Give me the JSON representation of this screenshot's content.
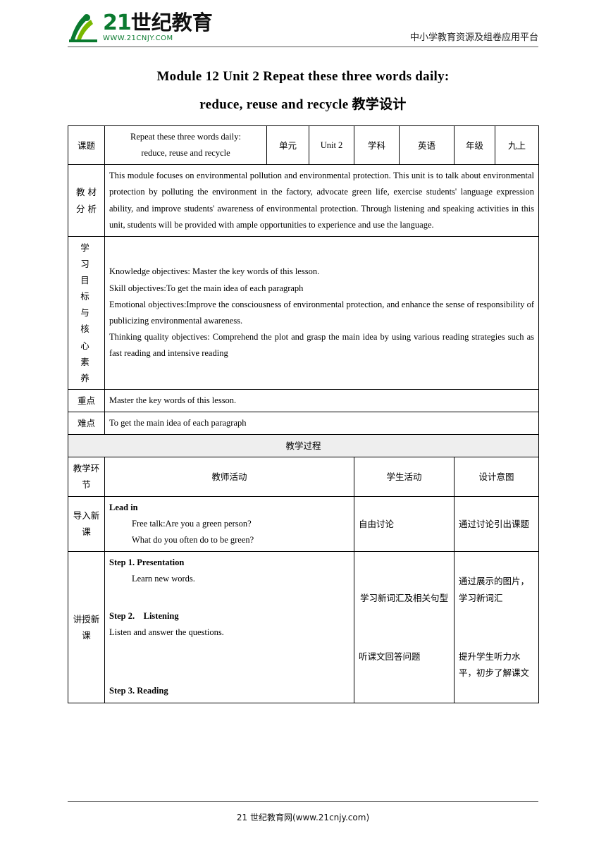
{
  "header": {
    "logo_number": "21",
    "logo_word": "世纪教育",
    "logo_url": "WWW.21CNJY.COM",
    "subtitle": "中小学教育资源及组卷应用平台"
  },
  "title": {
    "line1": "Module 12 Unit 2 Repeat these three words daily:",
    "line2": "reduce, reuse and recycle 教学设计"
  },
  "info": {
    "topic_label": "课题",
    "topic_value_line1": "Repeat these three words daily:",
    "topic_value_line2": "reduce, reuse and recycle",
    "unit_label": "单元",
    "unit_value": "Unit 2",
    "subject_label": "学科",
    "subject_value": "英语",
    "grade_label": "年级",
    "grade_value": "九上",
    "analysis_label_line1": "教 材",
    "analysis_label_line2": "分 析",
    "analysis_text": "This module focuses on environmental pollution and environmental protection. This unit is to talk about environmental protection by polluting the environment in the factory, advocate green life, exercise students' language expression ability, and improve students' awareness of environmental protection. Through listening and speaking activities in this unit, students will be provided with ample opportunities to experience and use the language.",
    "objectives_label": [
      "学 习",
      "目 标",
      "与 核",
      "心 素",
      "养"
    ],
    "objectives": [
      "Knowledge objectives: Master the key words of this lesson.",
      "Skill objectives:To get the main idea of each paragraph",
      "Emotional objectives:Improve the consciousness of environmental protection, and enhance the sense of responsibility of publicizing environmental awareness.",
      "Thinking quality objectives: Comprehend the plot and grasp the main idea by using various reading strategies such as fast reading and intensive reading"
    ],
    "key_point_label": "重点",
    "key_point_value": "Master the key words of this lesson.",
    "difficult_point_label": "难点",
    "difficult_point_value": "To get the main idea of each paragraph"
  },
  "process": {
    "band_label": "教学过程",
    "columns": [
      "教学环节",
      "教师活动",
      "学生活动",
      "设计意图"
    ],
    "rows": [
      {
        "stage": "导入新课",
        "teacher_title": "Lead in",
        "teacher_lines": [
          "Free talk:Are you a green person?",
          "What do you often do to be green?"
        ],
        "student": "自由讨论",
        "intent": "通过讨论引出课题"
      },
      {
        "stage": "讲授新课",
        "teacher_title": "Step 1. Presentation",
        "teacher_lines": [
          "Learn new words."
        ],
        "teacher_title2": "Step 2.　Listening",
        "teacher_lines2": [
          "Listen and answer the questions."
        ],
        "teacher_title3": "Step 3. Reading",
        "student1": "学习新词汇及相关句型",
        "student2": "听课文回答问题",
        "intent1": "通过展示的图片，学习新词汇",
        "intent2": "提升学生听力水平，初步了解课文"
      }
    ]
  },
  "footer": {
    "text": "21 世纪教育网(www.21cnjy.com)"
  }
}
